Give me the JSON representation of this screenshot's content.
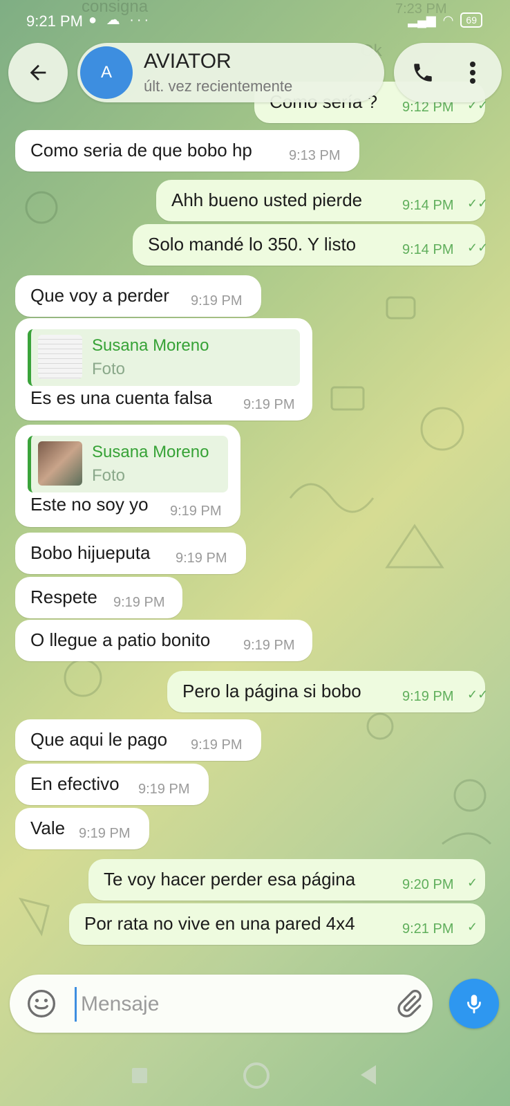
{
  "status_bar": {
    "time": "9:21 PM",
    "battery": "69"
  },
  "ghost_text": {
    "top_left": "consigna",
    "top_right_time": "7:23 PM",
    "ok": "Ok"
  },
  "header": {
    "avatar_letter": "A",
    "chat_name": "AVIATOR",
    "chat_status": "últ. vez recientemente"
  },
  "messages": [
    {
      "dir": "out",
      "text": "Como sería ?",
      "time": "9:12 PM",
      "status": "read"
    },
    {
      "dir": "in",
      "text": "Como seria de que bobo hp",
      "time": "9:13 PM"
    },
    {
      "dir": "out",
      "text": "Ahh bueno usted pierde",
      "time": "9:14 PM",
      "status": "read"
    },
    {
      "dir": "out",
      "text": "Solo mandé lo 350. Y listo",
      "time": "9:14 PM",
      "status": "read"
    },
    {
      "dir": "in",
      "text": "Que voy a perder",
      "time": "9:19 PM"
    },
    {
      "dir": "in",
      "text": "Es es una cuenta falsa",
      "time": "9:19 PM",
      "quote": {
        "name": "Susana Moreno",
        "type": "Foto"
      }
    },
    {
      "dir": "in",
      "text": "Este no soy yo",
      "time": "9:19 PM",
      "quote": {
        "name": "Susana Moreno",
        "type": "Foto"
      }
    },
    {
      "dir": "in",
      "text": "Bobo hijueputa",
      "time": "9:19 PM"
    },
    {
      "dir": "in",
      "text": "Respete",
      "time": "9:19 PM"
    },
    {
      "dir": "in",
      "text": "O llegue a patio bonito",
      "time": "9:19 PM"
    },
    {
      "dir": "out",
      "text": "Pero la página si bobo",
      "time": "9:19 PM",
      "status": "read"
    },
    {
      "dir": "in",
      "text": "Que aqui le pago",
      "time": "9:19 PM"
    },
    {
      "dir": "in",
      "text": "En efectivo",
      "time": "9:19 PM"
    },
    {
      "dir": "in",
      "text": "Vale",
      "time": "9:19 PM"
    },
    {
      "dir": "out",
      "text": "Te voy hacer perder esa página",
      "time": "9:20 PM",
      "status": "sent"
    },
    {
      "dir": "out",
      "text": "Por rata no vive en una pared 4x4",
      "time": "9:21 PM",
      "status": "sent"
    }
  ],
  "input": {
    "placeholder": "Mensaje",
    "value": ""
  },
  "icons": [
    "back-arrow-icon",
    "phone-icon",
    "more-vert-icon",
    "emoji-icon",
    "paperclip-icon",
    "mic-icon"
  ],
  "colors": {
    "accent": "#2e97f0",
    "avatar": "#3d8ee0",
    "quote_name": "#36a236",
    "out_bubble": "#eefbdf",
    "in_bubble": "#ffffff"
  }
}
